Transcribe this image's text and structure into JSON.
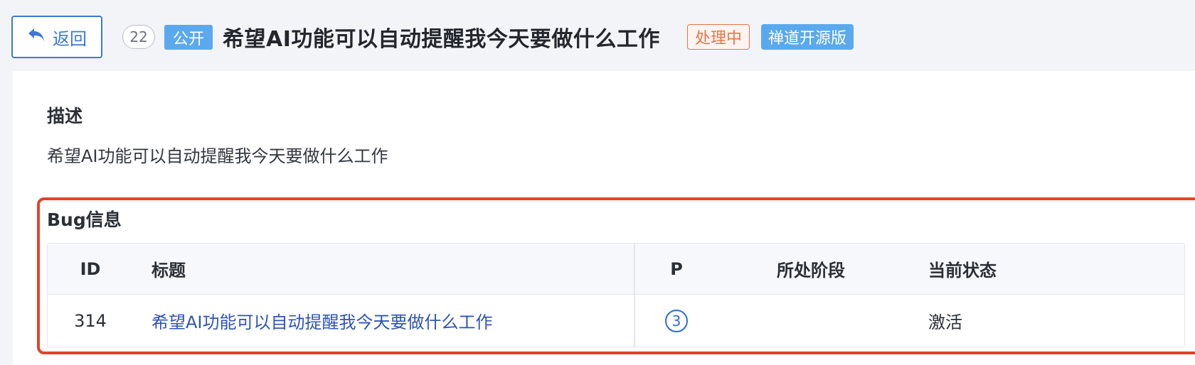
{
  "header": {
    "back_label": "返回",
    "id_badge": "22",
    "visibility_tag": "公开",
    "title": "希望AI功能可以自动提醒我今天要做什么工作",
    "status_tag": "处理中",
    "product_tag": "禅道开源版"
  },
  "description": {
    "heading": "描述",
    "text": "希望AI功能可以自动提醒我今天要做什么工作"
  },
  "bug_info": {
    "heading": "Bug信息",
    "columns": {
      "id": "ID",
      "title": "标题",
      "priority": "P",
      "stage": "所处阶段",
      "state": "当前状态"
    },
    "rows": [
      {
        "id": "314",
        "title": "希望AI功能可以自动提醒我今天要做什么工作",
        "priority": "3",
        "stage": "",
        "state": "激活"
      }
    ]
  },
  "colors": {
    "accent": "#3c78d8",
    "tag_blue": "#5aa9ee",
    "status_orange": "#e8744a",
    "highlight_red": "#e3432b"
  },
  "icons": {
    "back": "return-arrow-icon"
  }
}
